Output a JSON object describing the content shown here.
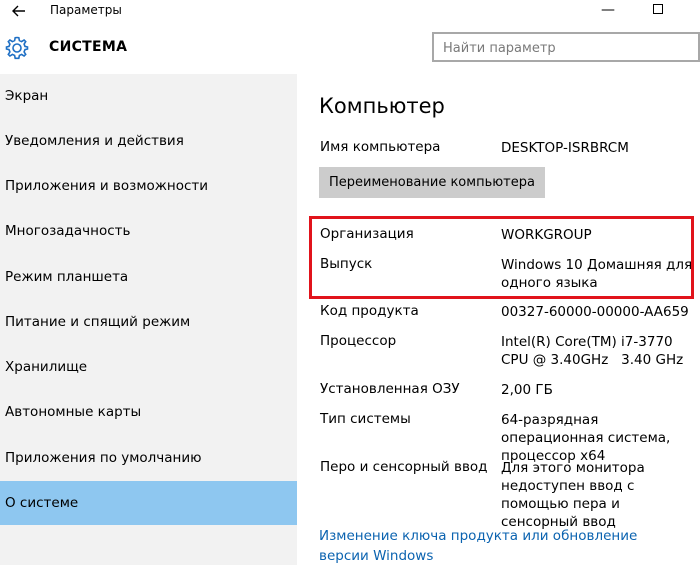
{
  "window": {
    "title": "Параметры",
    "minimize_glyph": "—"
  },
  "header": {
    "section_title": "СИСТЕМА",
    "search_placeholder": "Найти параметр"
  },
  "sidebar": {
    "items": [
      {
        "label": "Экран"
      },
      {
        "label": "Уведомления и действия"
      },
      {
        "label": "Приложения и возможности"
      },
      {
        "label": "Многозадачность"
      },
      {
        "label": "Режим планшета"
      },
      {
        "label": "Питание и спящий режим"
      },
      {
        "label": "Хранилище"
      },
      {
        "label": "Автономные карты"
      },
      {
        "label": "Приложения по умолчанию"
      },
      {
        "label": "О системе",
        "active": true
      }
    ]
  },
  "main": {
    "title": "Компьютер",
    "computer_name_label": "Имя компьютера",
    "computer_name_value": "DESKTOP-ISRBRCM",
    "rename_button": "Переименование компьютера",
    "rows": [
      {
        "label": "Организация",
        "value": "WORKGROUP"
      },
      {
        "label": "Выпуск",
        "value": "Windows 10 Домашняя для одного языка"
      },
      {
        "label": "Код продукта",
        "value": "00327-60000-00000-AA659"
      },
      {
        "label": "Процессор",
        "value": "Intel(R) Core(TM) i7-3770 CPU @ 3.40GHz   3.40 GHz"
      },
      {
        "label": "Установленная ОЗУ",
        "value": "2,00 ГБ"
      },
      {
        "label": "Тип системы",
        "value": "64-разрядная операционная система, процессор x64"
      },
      {
        "label": "Перо и сенсорный ввод",
        "value": "Для этого монитора недоступен ввод с помощью пера и сенсорный ввод"
      }
    ],
    "change_key_link": "Изменение ключа продукта или обновление версии Windows"
  },
  "colors": {
    "sidebar_bg": "#f2f2f2",
    "active_item": "#8ec7f0",
    "highlight_border": "#e1131b",
    "link": "#0b63b0",
    "button_bg": "#cccccc"
  },
  "icons": {
    "back": "arrow-left-icon",
    "settings": "gear-icon"
  }
}
